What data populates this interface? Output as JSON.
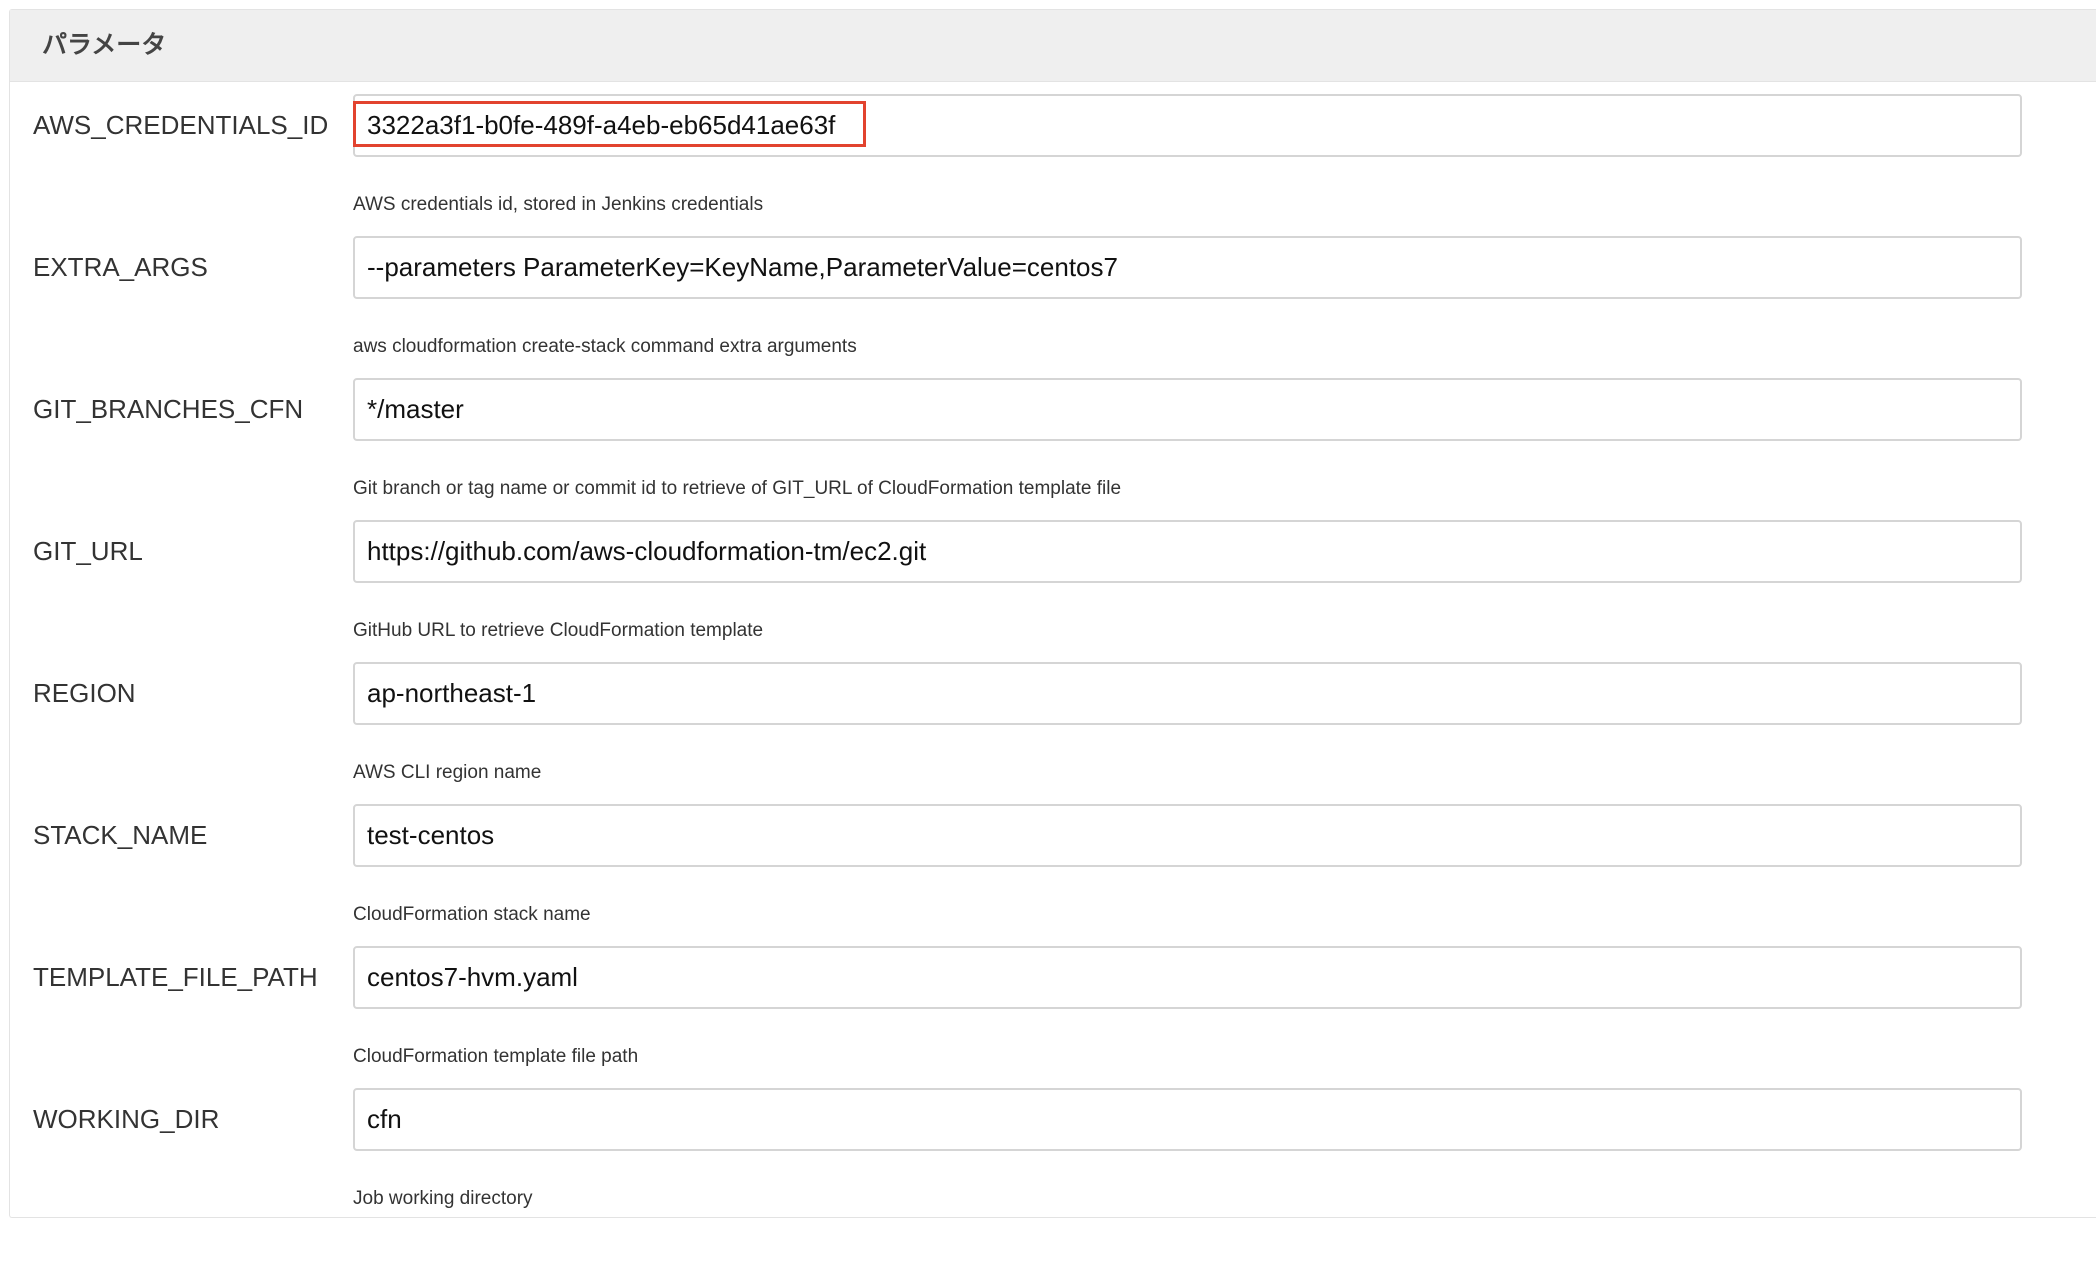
{
  "panel": {
    "title": "パラメータ"
  },
  "parameters": [
    {
      "name": "AWS_CREDENTIALS_ID",
      "value": "3322a3f1-b0fe-489f-a4eb-eb65d41ae63f",
      "description": "AWS credentials id, stored in Jenkins credentials"
    },
    {
      "name": "EXTRA_ARGS",
      "value": "--parameters ParameterKey=KeyName,ParameterValue=centos7",
      "description": "aws cloudformation create-stack command extra arguments"
    },
    {
      "name": "GIT_BRANCHES_CFN",
      "value": "*/master",
      "description": "Git branch or tag name or commit id to retrieve of GIT_URL of CloudFormation template file"
    },
    {
      "name": "GIT_URL",
      "value": "https://github.com/aws-cloudformation-tm/ec2.git",
      "description": "GitHub URL to retrieve CloudFormation template"
    },
    {
      "name": "REGION",
      "value": "ap-northeast-1",
      "description": "AWS CLI region name"
    },
    {
      "name": "STACK_NAME",
      "value": "test-centos",
      "description": "CloudFormation stack name"
    },
    {
      "name": "TEMPLATE_FILE_PATH",
      "value": "centos7-hvm.yaml",
      "description": "CloudFormation template file path"
    },
    {
      "name": "WORKING_DIR",
      "value": "cfn",
      "description": "Job working directory"
    }
  ],
  "colors": {
    "highlight": "#e2432f",
    "header_bg": "#efefef",
    "input_border": "#d5d5d5"
  }
}
